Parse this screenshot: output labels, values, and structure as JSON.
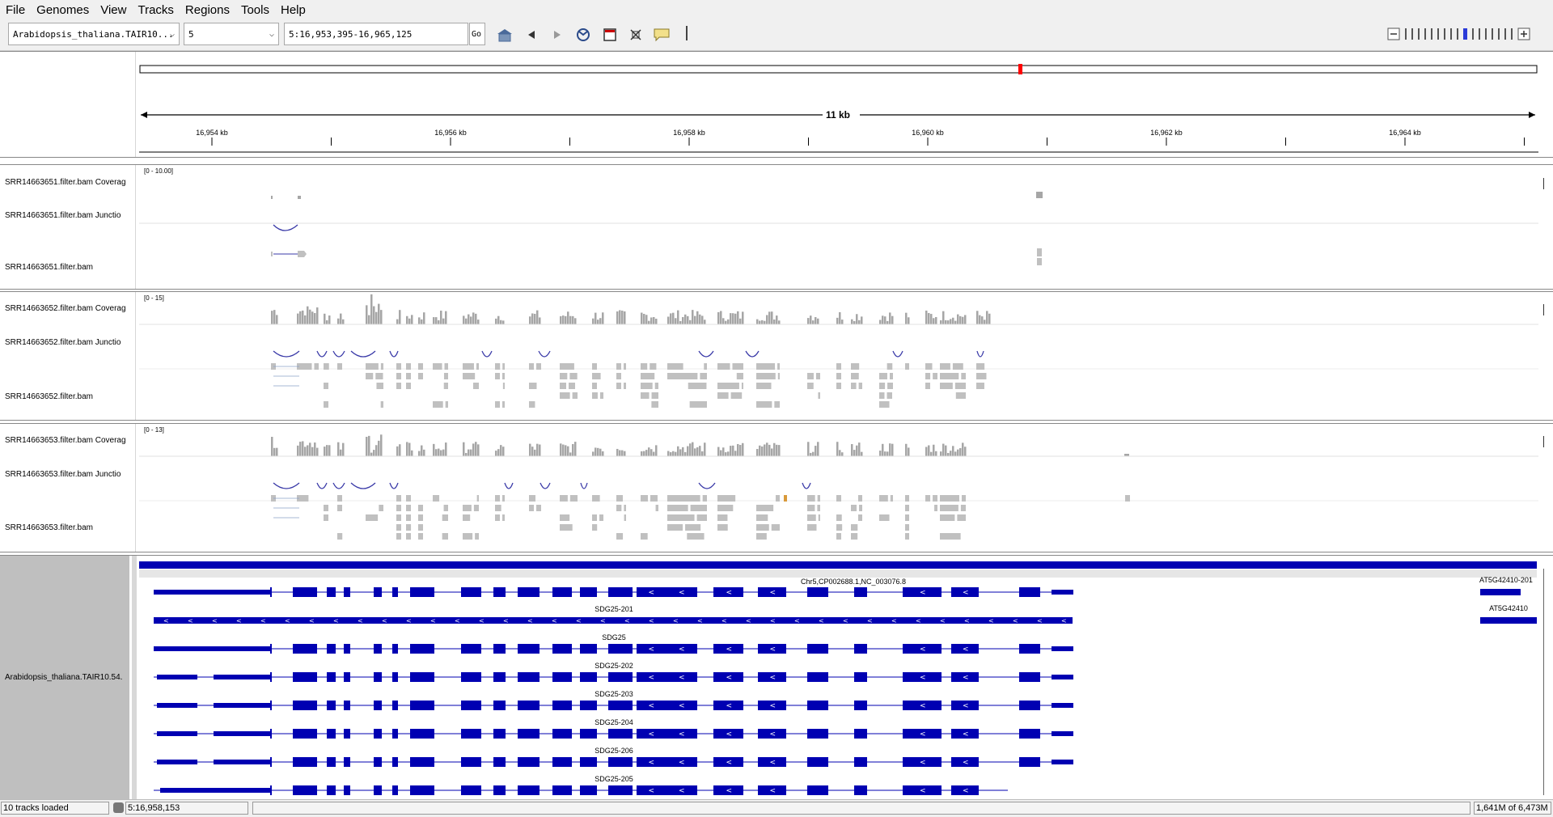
{
  "menu": [
    "File",
    "Genomes",
    "View",
    "Tracks",
    "Regions",
    "Tools",
    "Help"
  ],
  "toolbar": {
    "genome": "Arabidopsis_thaliana.TAIR10...",
    "chromosome": "5",
    "locus": "5:16,953,395-16,965,125",
    "go_label": "Go",
    "buttons": [
      "home-icon",
      "back-icon",
      "forward-icon",
      "refresh-icon",
      "region-icon",
      "resize-icon",
      "popup-info-icon"
    ]
  },
  "ruler": {
    "span_label": "11 kb",
    "ticks": [
      "16,954 kb",
      "16,956 kb",
      "16,958 kb",
      "16,960 kb",
      "16,962 kb",
      "16,964 kb"
    ]
  },
  "tracks": [
    {
      "coverage_name": "SRR14663651.filter.bam Coverag",
      "junction_name": "SRR14663651.filter.bam Junctio",
      "bam_name": "SRR14663651.filter.bam",
      "range": "[0 - 10.00]"
    },
    {
      "coverage_name": "SRR14663652.filter.bam Coverag",
      "junction_name": "SRR14663652.filter.bam Junctio",
      "bam_name": "SRR14663652.filter.bam",
      "range": "[0 - 15]"
    },
    {
      "coverage_name": "SRR14663653.filter.bam Coverag",
      "junction_name": "SRR14663653.filter.bam Junctio",
      "bam_name": "SRR14663653.filter.bam",
      "range": "[0 - 13]"
    }
  ],
  "annotation": {
    "track_name": "Arabidopsis_thaliana.TAIR10.54.",
    "sequence_label": "Chr5,CP002688.1,NC_003076.8",
    "transcripts": [
      "SDG25-201",
      "SDG25",
      "SDG25-202",
      "SDG25-203",
      "SDG25-204",
      "SDG25-206",
      "SDG25-205"
    ],
    "right_genes": [
      "AT5G42410-201",
      "AT5G42410"
    ]
  },
  "colors": {
    "feature": "#0000b2",
    "coverage": "#a6a6a6",
    "junction": "#3a3aa8",
    "read": "#c0c0c0",
    "locus_marker": "#ff0000"
  },
  "status": {
    "tracks_loaded": "10 tracks loaded",
    "position": "5:16,958,153",
    "memory": "1,641M of 6,473M"
  }
}
